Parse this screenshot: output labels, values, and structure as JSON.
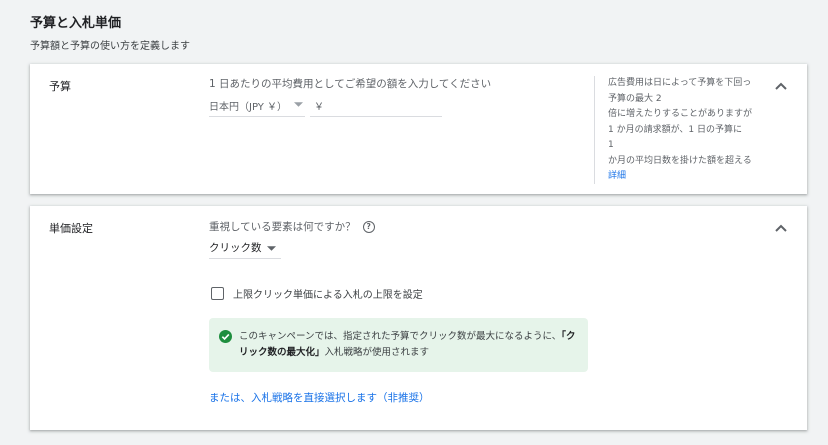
{
  "header": {
    "title": "予算と入札単価",
    "subtitle": "予算額と予算の使い方を定義します"
  },
  "budget": {
    "label": "予算",
    "prompt": "1 日あたりの平均費用としてご希望の額を入力してください",
    "currency": "日本円（JPY ￥）",
    "amount_prefix": "￥",
    "amount_value": "",
    "help_lines": [
      "広告費用は日によって予算を下回っ",
      "予算の最大 2",
      "倍に増えたりすることがありますが",
      "1 か月の請求額が、1 日の予算に",
      "1",
      "か月の平均日数を掛けた額を超える"
    ],
    "help_link": "詳細"
  },
  "bidding": {
    "label": "単価設定",
    "question": "重視している要素は何ですか？",
    "help_icon": "?",
    "focus_value": "クリック数",
    "checkbox_label": "上限クリック単価による入札の上限を設定",
    "checkbox_checked": false,
    "info_prefix": "このキャンペーンでは、指定された予算でクリック数が最大になるように、",
    "info_strategy": "「クリック数の最大化」",
    "info_suffix": "入札戦略が使用されます",
    "strategy_link": "または、入札戦略を直接選択します（非推奨）"
  },
  "colors": {
    "accent": "#1a73e8",
    "success": "#1e8e3e",
    "info_bg": "#e6f4ea"
  }
}
